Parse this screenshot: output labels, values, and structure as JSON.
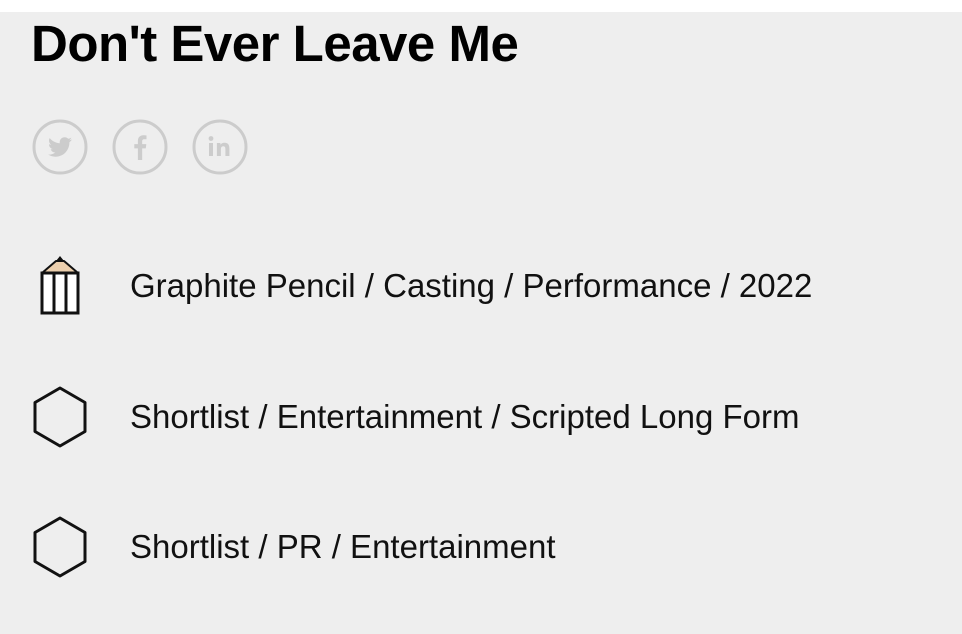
{
  "page": {
    "title": "Don't Ever Leave Me",
    "background": "#eeeeee",
    "social_icon_color": "#cccccc"
  },
  "social": [
    {
      "name": "twitter-icon"
    },
    {
      "name": "facebook-icon"
    },
    {
      "name": "linkedin-icon"
    }
  ],
  "awards": [
    {
      "icon": "graphite-pencil-icon",
      "text": "Graphite Pencil / Casting / Performance / 2022"
    },
    {
      "icon": "hexagon-outline-icon",
      "text": "Shortlist / Entertainment / Scripted Long Form"
    },
    {
      "icon": "hexagon-outline-icon",
      "text": "Shortlist / PR / Entertainment"
    }
  ]
}
